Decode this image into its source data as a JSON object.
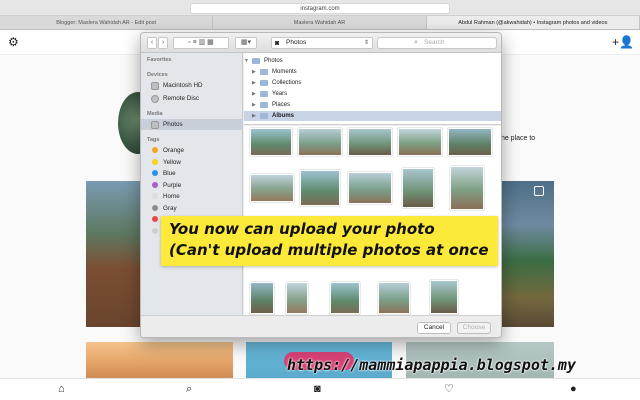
{
  "browser": {
    "url": "instagram.com",
    "tabs": [
      {
        "label": "Blogger: Maslera Wahidah AR - Edit post",
        "active": false
      },
      {
        "label": "Maslera Wahidah AR",
        "active": false
      },
      {
        "label": "Abdul Rahman (@akwahidah) • Instagram photos and videos",
        "active": true
      }
    ]
  },
  "instagram": {
    "bio_fragment": "the place to"
  },
  "dialog": {
    "location": "Photos",
    "search_placeholder": "Search",
    "sidebar": {
      "favorites_heading": "Favorites",
      "devices_heading": "Devices",
      "devices": [
        "Macintosh HD",
        "Remote Disc"
      ],
      "media_heading": "Media",
      "media_items": [
        "Photos"
      ],
      "tags_heading": "Tags",
      "tags": [
        {
          "label": "Orange",
          "color": "#f5a623"
        },
        {
          "label": "Yellow",
          "color": "#f8d21c"
        },
        {
          "label": "Blue",
          "color": "#2a93e8"
        },
        {
          "label": "Purple",
          "color": "#a55fcc"
        },
        {
          "label": "Home",
          "color": "#dcdcdc"
        },
        {
          "label": "Gray",
          "color": "#8e8e8e"
        },
        {
          "label": "",
          "color": "#e84a4a"
        },
        {
          "label": "",
          "color": "#cfcfcf"
        }
      ]
    },
    "browser_rows": [
      {
        "label": "Photos",
        "level": 0,
        "selected": false
      },
      {
        "label": "Moments",
        "level": 1,
        "selected": false
      },
      {
        "label": "Collections",
        "level": 1,
        "selected": false
      },
      {
        "label": "Years",
        "level": 1,
        "selected": false
      },
      {
        "label": "Places",
        "level": 1,
        "selected": false
      },
      {
        "label": "Albums",
        "level": 1,
        "selected": true
      }
    ],
    "cancel_label": "Cancel",
    "choose_label": "Choose"
  },
  "overlay": {
    "line1": "You now can upload your photo",
    "line2": "(Can't upload multiple photos at once",
    "watermark": "https://mammiapappia.blogspot.my"
  },
  "colors": {
    "instagram_button": "#d84377",
    "banner_bg": "#fde93a",
    "selection": "#c9d3e6"
  }
}
